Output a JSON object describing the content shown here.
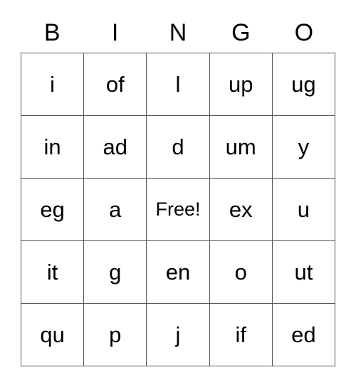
{
  "card": {
    "header": {
      "letters": [
        "B",
        "I",
        "N",
        "G",
        "O"
      ]
    },
    "free_space_label": "Free!",
    "grid": {
      "columns": 5,
      "rows": 5,
      "cells": [
        [
          "i",
          "of",
          "l",
          "up",
          "ug"
        ],
        [
          "in",
          "ad",
          "d",
          "um",
          "y"
        ],
        [
          "eg",
          "a",
          "Free!",
          "ex",
          "u"
        ],
        [
          "it",
          "g",
          "en",
          "o",
          "ut"
        ],
        [
          "qu",
          "p",
          "j",
          "if",
          "ed"
        ]
      ]
    },
    "colors": {
      "background": "#ffffff",
      "text": "#000000",
      "grid_line": "#555555"
    }
  }
}
